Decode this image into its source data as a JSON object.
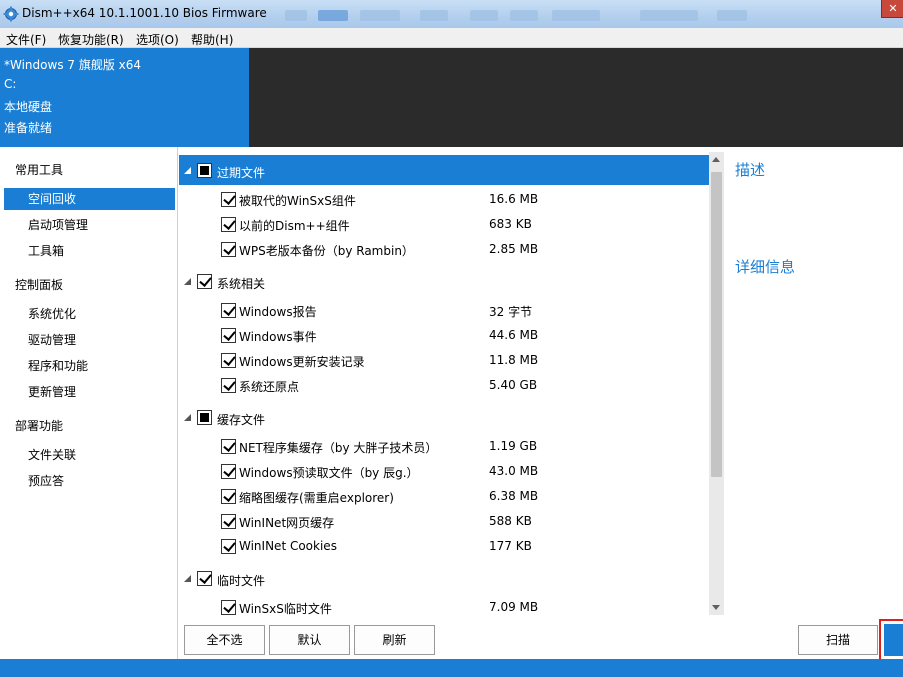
{
  "window": {
    "title": "Dism++x64 10.1.1001.10 Bios Firmware",
    "close_label": "✕"
  },
  "menu": [
    "文件(F)",
    "恢复功能(R)",
    "选项(O)",
    "帮助(H)"
  ],
  "system": {
    "os": "*Windows 7 旗舰版 x64",
    "drive": "C:",
    "disk": "本地硬盘",
    "status": "准备就绪"
  },
  "nav": {
    "sections": [
      {
        "title": "常用工具",
        "items": [
          "空间回收",
          "启动项管理",
          "工具箱"
        ]
      },
      {
        "title": "控制面板",
        "items": [
          "系统优化",
          "驱动管理",
          "程序和功能",
          "更新管理"
        ]
      },
      {
        "title": "部署功能",
        "items": [
          "文件关联",
          "预应答"
        ]
      }
    ],
    "active_item": "空间回收"
  },
  "groups": [
    {
      "label": "过期文件",
      "state": "partial",
      "active": true,
      "items": [
        {
          "label": "被取代的WinSxS组件",
          "size": "16.6 MB"
        },
        {
          "label": "以前的Dism++组件",
          "size": "683 KB"
        },
        {
          "label": "WPS老版本备份（by Rambin）",
          "size": "2.85 MB"
        }
      ]
    },
    {
      "label": "系统相关",
      "state": "checked",
      "active": false,
      "items": [
        {
          "label": "Windows报告",
          "size": "32 字节"
        },
        {
          "label": "Windows事件",
          "size": "44.6 MB"
        },
        {
          "label": "Windows更新安装记录",
          "size": "11.8 MB"
        },
        {
          "label": "系统还原点",
          "size": "5.40 GB"
        }
      ]
    },
    {
      "label": "缓存文件",
      "state": "partial",
      "active": false,
      "items": [
        {
          "label": "NET程序集缓存（by 大胖子技术员）",
          "size": "1.19 GB"
        },
        {
          "label": "Windows预读取文件（by 辰g.）",
          "size": "43.0 MB"
        },
        {
          "label": "缩略图缓存(需重启explorer)",
          "size": "6.38 MB"
        },
        {
          "label": "WinINet网页缓存",
          "size": "588 KB"
        },
        {
          "label": "WinINet Cookies",
          "size": "177 KB"
        }
      ]
    },
    {
      "label": "临时文件",
      "state": "checked",
      "active": false,
      "items": [
        {
          "label": "WinSxS临时文件",
          "size": "7.09 MB"
        }
      ]
    }
  ],
  "details": {
    "description_heading": "描述",
    "info_heading": "详细信息"
  },
  "buttons": {
    "deselect_all": "全不选",
    "default": "默认",
    "refresh": "刷新",
    "scan": "扫描"
  },
  "colors": {
    "accent": "#1a7fd4",
    "dark_panel": "#2b2b2b",
    "highlight_border": "#e0201a"
  }
}
